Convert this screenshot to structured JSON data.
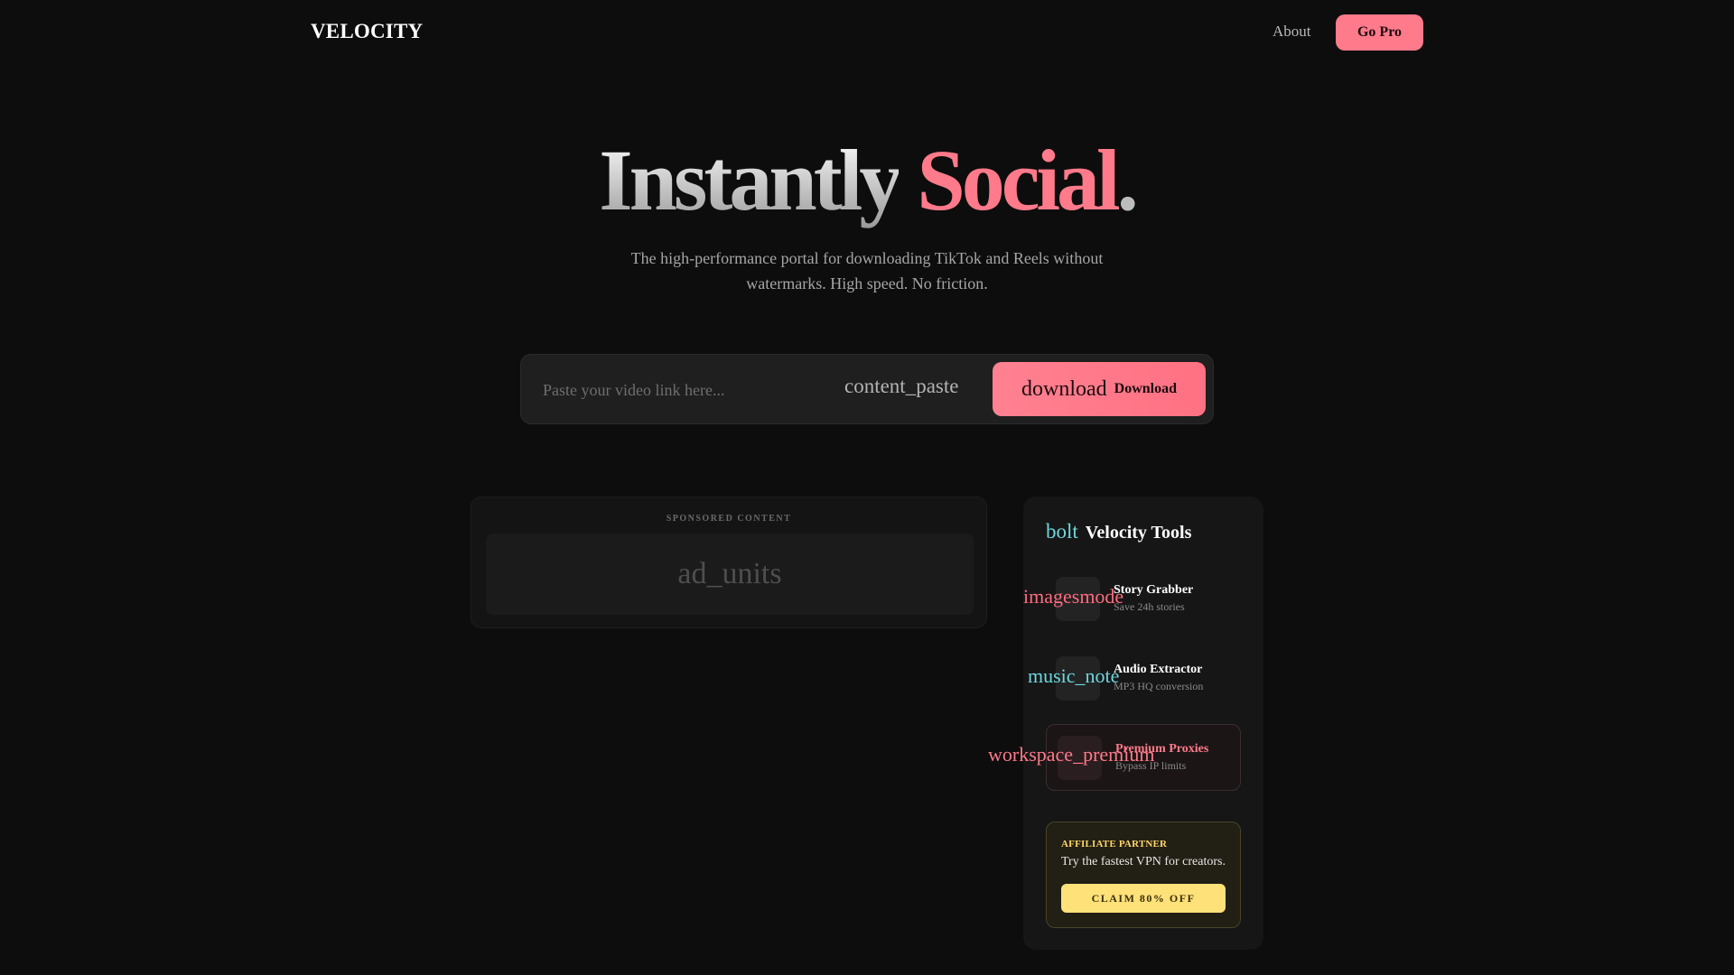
{
  "header": {
    "logo": "VELOCITY",
    "nav_about": "About",
    "go_pro": "Go Pro"
  },
  "hero": {
    "title_word1": "Instantly",
    "title_word2": "Social",
    "title_dot": ".",
    "subtitle": "The high-performance portal for downloading TikTok and Reels without watermarks. High speed. No friction."
  },
  "search": {
    "placeholder": "Paste your video link here...",
    "value": "",
    "paste_icon": "content_paste",
    "download_icon": "download",
    "download_label": "Download"
  },
  "sponsored": {
    "label": "SPONSORED CONTENT",
    "ad_icon": "ad_units"
  },
  "tools": {
    "title_icon": "bolt",
    "title": "Velocity Tools",
    "items": [
      {
        "icon": "imagesmode",
        "name": "Story Grabber",
        "desc": "Save 24h stories"
      },
      {
        "icon": "music_note",
        "name": "Audio Extractor",
        "desc": "MP3 HQ conversion"
      },
      {
        "icon": "workspace_premium",
        "name": "Premium Proxies",
        "desc": "Bypass IP limits"
      }
    ],
    "affiliate": {
      "label": "AFFILIATE PARTNER",
      "text": "Try the fastest VPN for creators.",
      "button": "CLAIM 80% OFF"
    }
  },
  "colors": {
    "accent": "#ff7a8a",
    "cyan": "#6fd7df",
    "gold": "#ffe17a",
    "background": "#0d0d0d"
  }
}
